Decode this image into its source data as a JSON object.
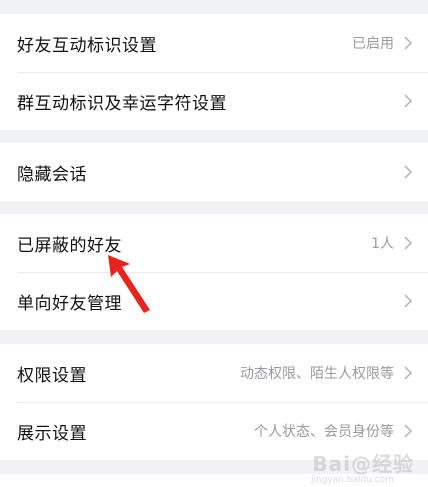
{
  "groups": [
    {
      "rows": [
        {
          "label": "好友互动标识设置",
          "value": "已启用"
        },
        {
          "label": "群互动标识及幸运字符设置",
          "value": ""
        }
      ]
    },
    {
      "rows": [
        {
          "label": "隐藏会话",
          "value": ""
        }
      ]
    },
    {
      "rows": [
        {
          "label": "已屏蔽的好友",
          "value": "1人"
        },
        {
          "label": "单向好友管理",
          "value": ""
        }
      ]
    },
    {
      "rows": [
        {
          "label": "权限设置",
          "value": "动态权限、陌生人权限等"
        },
        {
          "label": "展示设置",
          "value": "个人状态、会员身份等"
        }
      ]
    }
  ],
  "annotation_arrow": {
    "color": "#e8231e"
  },
  "watermark": {
    "text": "Bai@经验",
    "sub": "jingyan.baidu.com"
  },
  "colors": {
    "background": "#f1f2f4",
    "card": "#ffffff",
    "label": "#111111",
    "secondary": "#9a9a9f",
    "chevron": "#b8b8bd"
  }
}
